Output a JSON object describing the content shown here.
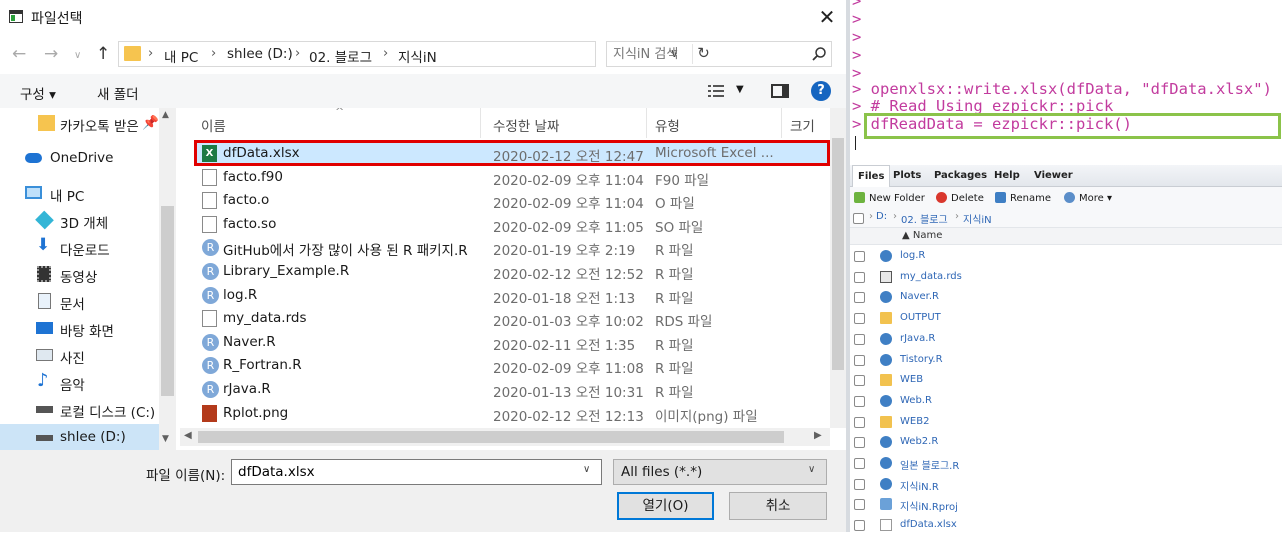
{
  "dialog": {
    "title": "파일선택",
    "close_label": "✕",
    "breadcrumbs": [
      "내 PC",
      "shlee (D:)",
      "02. 블로그",
      "지식iN"
    ],
    "search_placeholder": "지식iN 검색",
    "organize_label": "구성 ▾",
    "new_folder_label": "새 폴더",
    "help_label": "?",
    "nav_items": [
      {
        "label": "카카오톡 받은",
        "icon": "folder-icon"
      },
      {
        "label": "OneDrive",
        "icon": "cloud-icon"
      },
      {
        "label": "내 PC",
        "icon": "computer-icon"
      },
      {
        "label": "3D 개체",
        "icon": "cube-icon"
      },
      {
        "label": "다운로드",
        "icon": "download-icon"
      },
      {
        "label": "동영상",
        "icon": "video-icon"
      },
      {
        "label": "문서",
        "icon": "document-icon"
      },
      {
        "label": "바탕 화면",
        "icon": "desktop-icon"
      },
      {
        "label": "사진",
        "icon": "picture-icon"
      },
      {
        "label": "음악",
        "icon": "music-icon"
      },
      {
        "label": "로컬 디스크 (C:)",
        "icon": "drive-icon"
      },
      {
        "label": "shlee (D:)",
        "icon": "drive-icon"
      }
    ],
    "columns": {
      "name": "이름",
      "date": "수정한 날짜",
      "type": "유형",
      "size": "크기"
    },
    "files": [
      {
        "name": "dfData.xlsx",
        "date": "2020-02-12 오전 12:47",
        "type": "Microsoft Excel ...",
        "icon": "excel-icon"
      },
      {
        "name": "facto.f90",
        "date": "2020-02-09 오후 11:04",
        "type": "F90 파일",
        "icon": "file-icon"
      },
      {
        "name": "facto.o",
        "date": "2020-02-09 오후 11:04",
        "type": "O 파일",
        "icon": "file-icon"
      },
      {
        "name": "facto.so",
        "date": "2020-02-09 오후 11:05",
        "type": "SO 파일",
        "icon": "file-icon"
      },
      {
        "name": "GitHub에서 가장 많이 사용 된 R 패키지.R",
        "date": "2020-01-19 오후 2:19",
        "type": "R 파일",
        "icon": "r-file-icon"
      },
      {
        "name": "Library_Example.R",
        "date": "2020-02-12 오전 12:52",
        "type": "R 파일",
        "icon": "r-file-icon"
      },
      {
        "name": "log.R",
        "date": "2020-01-18 오전 1:13",
        "type": "R 파일",
        "icon": "r-file-icon"
      },
      {
        "name": "my_data.rds",
        "date": "2020-01-03 오후 10:02",
        "type": "RDS 파일",
        "icon": "file-icon"
      },
      {
        "name": "Naver.R",
        "date": "2020-02-11 오전 1:35",
        "type": "R 파일",
        "icon": "r-file-icon"
      },
      {
        "name": "R_Fortran.R",
        "date": "2020-02-09 오후 11:08",
        "type": "R 파일",
        "icon": "r-file-icon"
      },
      {
        "name": "rJava.R",
        "date": "2020-01-13 오전 10:31",
        "type": "R 파일",
        "icon": "r-file-icon"
      },
      {
        "name": "Rplot.png",
        "date": "2020-02-12 오전 12:13",
        "type": "이미지(png) 파일",
        "icon": "image-icon"
      }
    ],
    "filename_label": "파일 이름(N):",
    "filename_value": "dfData.xlsx",
    "filter_value": "All files (*.*)",
    "open_label": "열기(O)",
    "cancel_label": "취소"
  },
  "console": {
    "prompts": [
      ">",
      ">",
      ">",
      ">",
      ">"
    ],
    "lines": [
      "> openxlsx::write.xlsx(dfData, \"dfData.xlsx\")",
      "> # Read Using ezpickr::pick",
      "> dfReadData = ezpickr::pick()"
    ]
  },
  "files_pane": {
    "tabs": [
      "Files",
      "Plots",
      "Packages",
      "Help",
      "Viewer"
    ],
    "tools": [
      "New Folder",
      "Delete",
      "Rename",
      "More ▾"
    ],
    "path": [
      "D:",
      "02. 블로그",
      "지식iN"
    ],
    "name_header": "▲ Name",
    "entries": [
      {
        "name": "log.R",
        "icon": "r-file-icon"
      },
      {
        "name": "my_data.rds",
        "icon": "rds-icon"
      },
      {
        "name": "Naver.R",
        "icon": "r-file-icon"
      },
      {
        "name": "OUTPUT",
        "icon": "folder-icon"
      },
      {
        "name": "rJava.R",
        "icon": "r-file-icon"
      },
      {
        "name": "Tistory.R",
        "icon": "r-file-icon"
      },
      {
        "name": "WEB",
        "icon": "folder-icon"
      },
      {
        "name": "Web.R",
        "icon": "r-file-icon"
      },
      {
        "name": "WEB2",
        "icon": "folder-icon"
      },
      {
        "name": "Web2.R",
        "icon": "r-file-icon"
      },
      {
        "name": "일본 블로그.R",
        "icon": "r-file-icon"
      },
      {
        "name": "지식iN.R",
        "icon": "r-file-icon"
      },
      {
        "name": "지식iN.Rproj",
        "icon": "rproj-icon"
      },
      {
        "name": "dfData.xlsx",
        "icon": "file-icon"
      }
    ]
  },
  "colors": {
    "highlight_red": "#e00000",
    "highlight_green": "#8bc34a",
    "console_text": "#c23b9e",
    "selection": "#cce8ff"
  }
}
